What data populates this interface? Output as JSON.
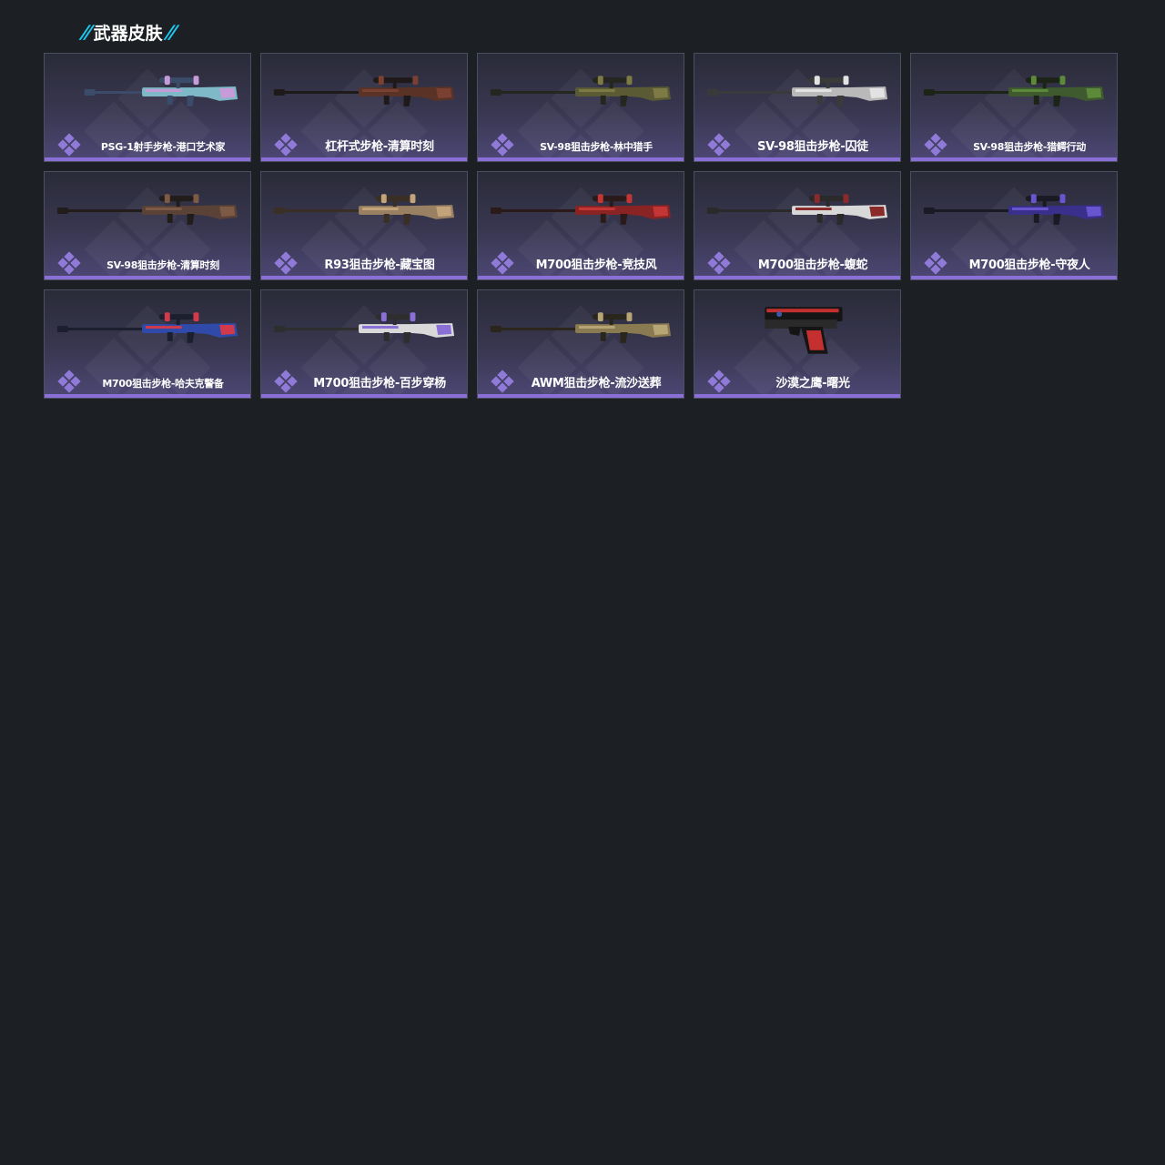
{
  "section": {
    "title": "武器皮肤"
  },
  "colors": {
    "accent_slash": "#1ec8f0",
    "rarity": "#8f7ad8",
    "card_bottom_bar": "#8a6fd6",
    "page_background": "#1c2025"
  },
  "skins": [
    {
      "name": "PSG-1射手步枪-港口艺术家",
      "icon": "sniper-rifle-psg1-icon",
      "theme": {
        "body": "#7fb9c7",
        "accent": "#c79ad8",
        "dark": "#3b4b6a"
      }
    },
    {
      "name": "杠杆式步枪-清算时刻",
      "icon": "lever-action-rifle-icon",
      "theme": {
        "body": "#5a3326",
        "accent": "#7a4032",
        "dark": "#1f1a19"
      }
    },
    {
      "name": "SV-98狙击步枪-林中猎手",
      "icon": "sniper-rifle-sv98-icon",
      "theme": {
        "body": "#5a5b34",
        "accent": "#7e7a45",
        "dark": "#262620"
      }
    },
    {
      "name": "SV-98狙击步枪-囚徒",
      "icon": "sniper-rifle-sv98-icon",
      "theme": {
        "body": "#b9b9b9",
        "accent": "#e2e2e2",
        "dark": "#3a3a3a"
      }
    },
    {
      "name": "SV-98狙击步枪-猎鳄行动",
      "icon": "sniper-rifle-sv98-icon",
      "theme": {
        "body": "#3e5a2e",
        "accent": "#5c8a3a",
        "dark": "#1c2418"
      }
    },
    {
      "name": "SV-98狙击步枪-清算时刻",
      "icon": "sniper-rifle-sv98-icon",
      "theme": {
        "body": "#5a4236",
        "accent": "#7d5a45",
        "dark": "#221c1a"
      }
    },
    {
      "name": "R93狙击步枪-藏宝图",
      "icon": "sniper-rifle-r93-icon",
      "theme": {
        "body": "#9a8062",
        "accent": "#c2a37a",
        "dark": "#3a2f25"
      }
    },
    {
      "name": "M700狙击步枪-竞技风",
      "icon": "sniper-rifle-m700-icon",
      "theme": {
        "body": "#8a2323",
        "accent": "#c43636",
        "dark": "#2a1a1a"
      }
    },
    {
      "name": "M700狙击步枪-蝮蛇",
      "icon": "sniper-rifle-m700-icon",
      "theme": {
        "body": "#d8d8d8",
        "accent": "#8a2a2a",
        "dark": "#2a2a2a"
      }
    },
    {
      "name": "M700狙击步枪-守夜人",
      "icon": "sniper-rifle-m700-icon",
      "theme": {
        "body": "#3a2f8a",
        "accent": "#6a55d0",
        "dark": "#1a1a24"
      }
    },
    {
      "name": "M700狙击步枪-哈夫克警备",
      "icon": "sniper-rifle-m700-icon",
      "theme": {
        "body": "#2f4aa8",
        "accent": "#d03a4a",
        "dark": "#1c1f2e"
      }
    },
    {
      "name": "M700狙击步枪-百步穿杨",
      "icon": "sniper-rifle-m700-icon",
      "theme": {
        "body": "#d9d9d9",
        "accent": "#8a6fd6",
        "dark": "#2e2e2e"
      }
    },
    {
      "name": "AWM狙击步枪-流沙送葬",
      "icon": "sniper-rifle-awm-icon",
      "theme": {
        "body": "#8a7a52",
        "accent": "#b8a575",
        "dark": "#2a261c"
      }
    },
    {
      "name": "沙漠之鹰-曙光",
      "icon": "pistol-desert-eagle-icon",
      "theme": {
        "body": "#2a2a2a",
        "accent": "#c43030",
        "dark": "#151515"
      }
    }
  ]
}
